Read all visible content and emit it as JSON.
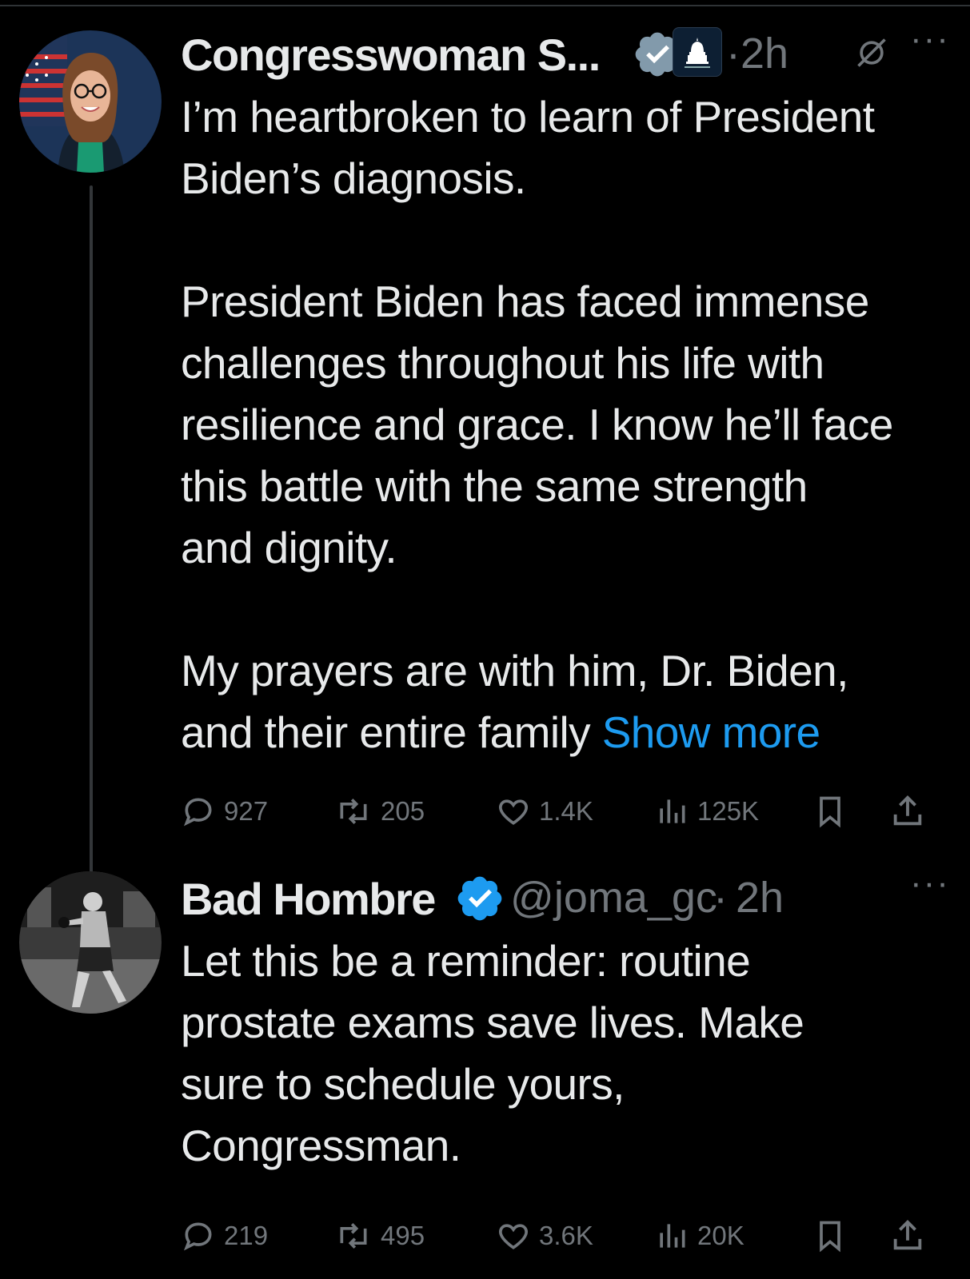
{
  "tweets": [
    {
      "display_name": "Congresswoman S...",
      "separator": "·",
      "time": "2h",
      "more": "···",
      "affiliation_badge": "capitol-house-democrats-icon",
      "text": [
        "I’m heartbroken to learn of President",
        "Biden’s diagnosis.",
        "President Biden has faced immense",
        "challenges throughout his life with",
        "resilience and grace. I know he’ll face",
        "this battle with the same strength",
        "and dignity.",
        "My prayers are with him, Dr. Biden,",
        "and their entire family"
      ],
      "show_more": "Show more",
      "stats": {
        "replies": "927",
        "reposts": "205",
        "likes": "1.4K",
        "views": "125K"
      }
    },
    {
      "display_name": "Bad Hombre",
      "handle": "@joma_gc",
      "separator": "·",
      "time": "2h",
      "more": "···",
      "text": [
        "Let this be a reminder: routine",
        "prostate exams save lives. Make",
        "sure to schedule yours,",
        "Congressman."
      ],
      "stats": {
        "replies": "219",
        "reposts": "495",
        "likes": "3.6K",
        "views": "20K"
      }
    }
  ],
  "colors": {
    "background": "#000000",
    "text": "#e7e9ea",
    "muted": "#71767b",
    "link": "#1d9bf0",
    "verified": "#1d9bf0"
  }
}
